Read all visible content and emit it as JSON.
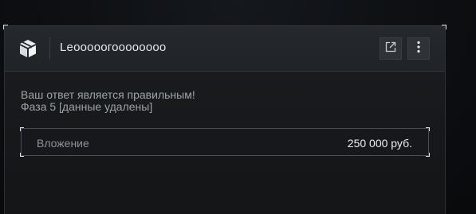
{
  "panel": {
    "title": "Leoooooгоооооооо",
    "header_icon": "box-icon",
    "actions": [
      {
        "name": "open-external",
        "icon": "external-link-icon"
      },
      {
        "name": "more-menu",
        "icon": "vertical-dots-icon"
      }
    ]
  },
  "message": {
    "line1": "Ваш ответ является правильным!",
    "line2": "Фаза 5  [данные удалены]"
  },
  "investment": {
    "label": "Вложение",
    "value": "250 000 руб."
  },
  "colors": {
    "background": "#0b0d11",
    "panel": "#1b1d20",
    "header": "#25282c",
    "text_primary": "#e7e9ec",
    "text_muted": "#9ea3a9"
  }
}
